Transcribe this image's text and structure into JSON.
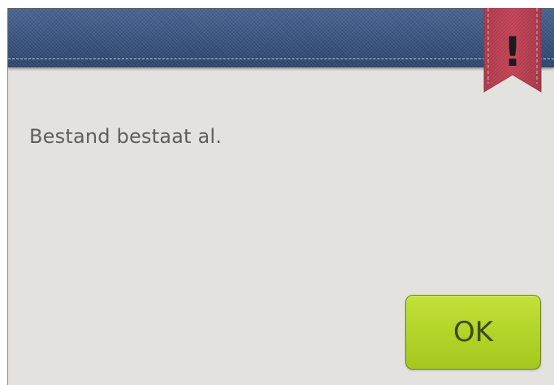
{
  "dialog": {
    "message": "Bestand bestaat al.",
    "ok_label": "OK",
    "alert_symbol": "!",
    "alert_icon": "exclamation-bookmark-icon"
  },
  "colors": {
    "header": "#3a5582",
    "ribbon": "#c84b5e",
    "background": "#e4e2de",
    "ok_button": "#b3d428",
    "text": "#5e5e5e"
  }
}
